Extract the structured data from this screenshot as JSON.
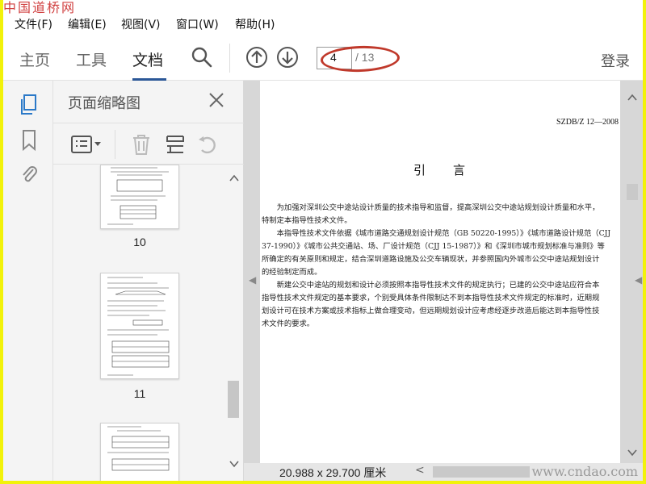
{
  "watermark_top": "中国道桥网",
  "title_fragment": "...",
  "menu": [
    {
      "label": "文件(F)"
    },
    {
      "label": "编辑(E)"
    },
    {
      "label": "视图(V)"
    },
    {
      "label": "窗口(W)"
    },
    {
      "label": "帮助(H)"
    }
  ],
  "toolbar": {
    "tabs": [
      {
        "label": "主页",
        "active": false
      },
      {
        "label": "工具",
        "active": false
      },
      {
        "label": "文档",
        "active": true
      }
    ],
    "page_current": "4",
    "page_total": "/ 13",
    "login": "登录"
  },
  "panel": {
    "title": "页面缩略图",
    "thumbnails": [
      {
        "label": "10"
      },
      {
        "label": "11"
      },
      {
        "label": ""
      }
    ]
  },
  "document": {
    "header": "SZDB/Z 12—2008",
    "title": "引言",
    "lines": [
      "　　为加强对深圳公交中途站设计质量的技术指导和监督，提高深圳公交中途站规划设计质量和水平，",
      "特制定本指导性技术文件。",
      "　　本指导性技术文件依据《城市道路交通规划设计规范（GB 50220-1995）》《城市道路设计规范（CJJ",
      "37-1990）》《城市公共交通站、场、厂设计规范（CJJ 15-1987）》和《深圳市城市规划标准与准则》等",
      "所确定的有关原则和规定，结合深圳道路设施及公交车辆现状，并参照国内外城市公交中途站规划设计",
      "的经验制定而成。",
      "　　新建公交中途站的规划和设计必须按照本指导性技术文件的规定执行；已建的公交中途站应符合本",
      "指导性技术文件规定的基本要求，个别受具体条件限制达不到本指导性技术文件规定的标准时，近期规",
      "划设计可在技术方案或技术指标上做合理变动，但远期规划设计应考虑经逐步改造后能达到本指导性技",
      "术文件的要求。"
    ]
  },
  "status": {
    "page_size": "20.988 x 29.700 厘米",
    "watermark": "www.cndao.com"
  },
  "colors": {
    "frame": "#f2f20a",
    "accent": "#2b5797",
    "annotation": "#c0392b"
  },
  "icons": [
    "search-icon",
    "arrow-up-circle-icon",
    "arrow-down-circle-icon",
    "page-thumbnails-icon",
    "bookmark-icon",
    "attachment-icon",
    "close-icon",
    "options-menu-icon",
    "trash-icon",
    "insert-page-icon",
    "rotate-icon"
  ]
}
